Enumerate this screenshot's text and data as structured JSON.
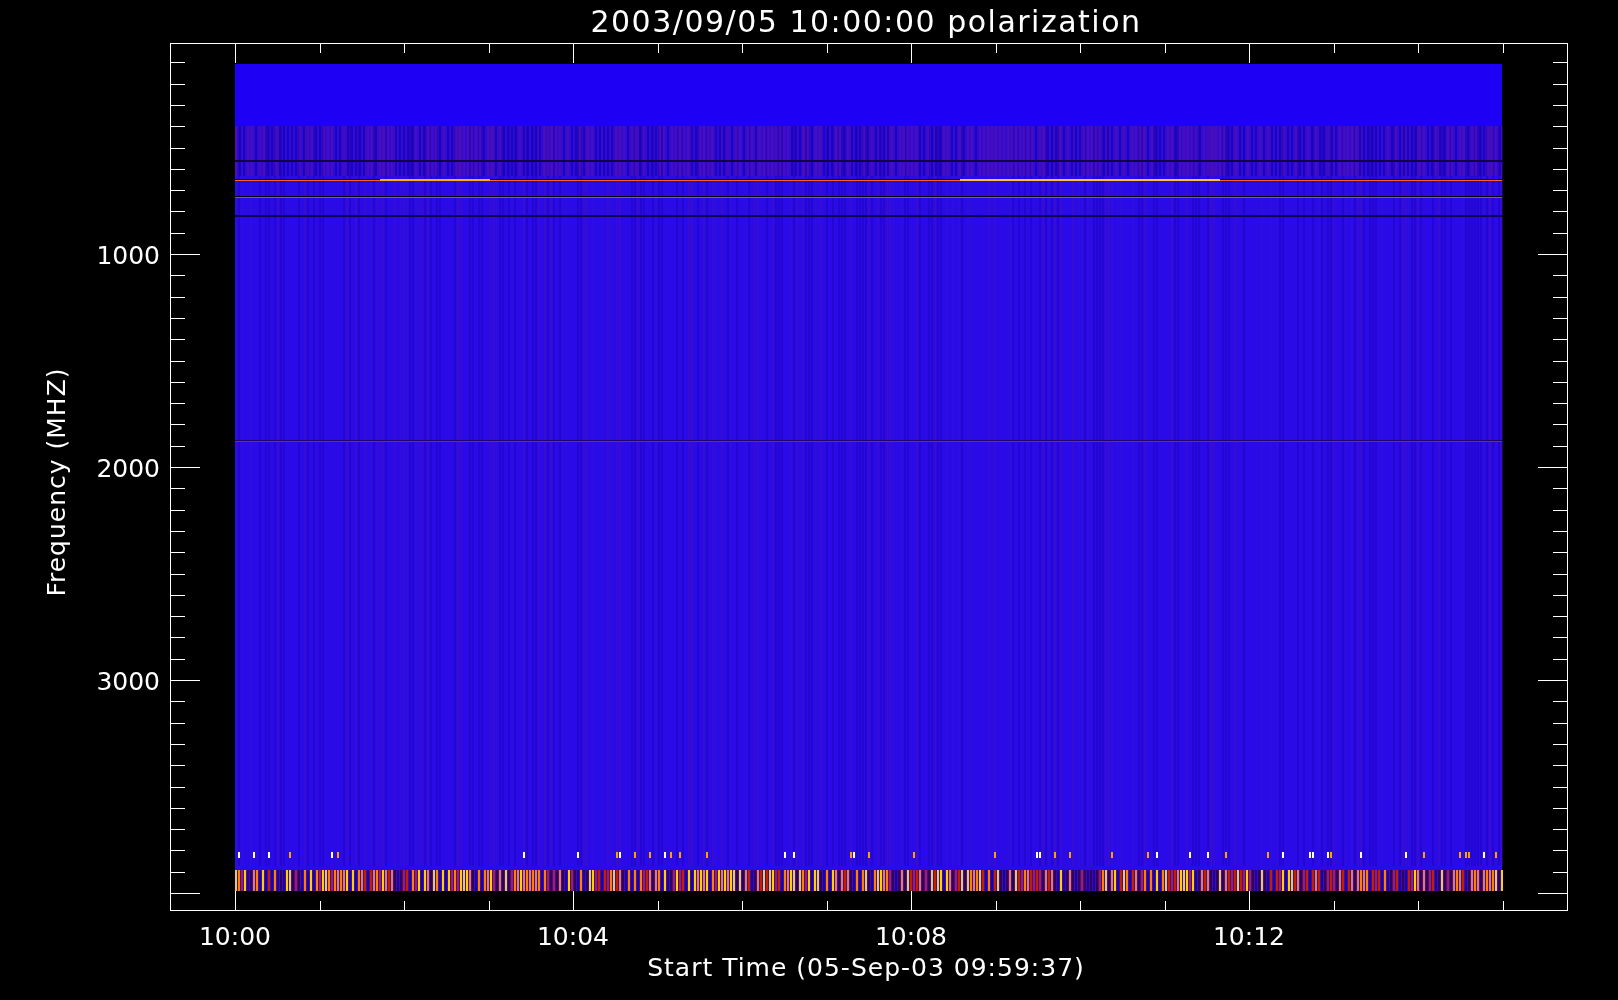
{
  "plot": {
    "title": "2003/09/05 10:00:00 polarization",
    "y_axis": {
      "label": "Frequency (MHZ)",
      "ticks": [
        "1000",
        "2000",
        "3000"
      ]
    },
    "x_axis": {
      "label": "Start Time (05-Sep-03 09:59:37)",
      "ticks": [
        "10:00",
        "10:04",
        "10:08",
        "10:12"
      ]
    }
  }
}
